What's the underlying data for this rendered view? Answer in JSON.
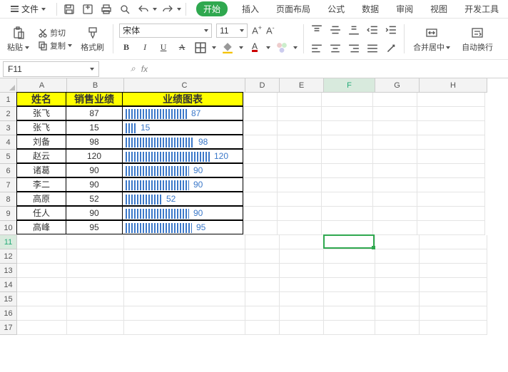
{
  "menu": {
    "file": "文件"
  },
  "tabs": [
    "开始",
    "插入",
    "页面布局",
    "公式",
    "数据",
    "审阅",
    "视图",
    "开发工具"
  ],
  "clipboard": {
    "paste": "粘贴",
    "cut": "剪切",
    "copy": "复制",
    "format_painter": "格式刷"
  },
  "font": {
    "name": "宋体",
    "size": "11",
    "b": "B",
    "i": "I",
    "u": "U",
    "a": "A"
  },
  "align": {
    "merge_center": "合并居中",
    "wrap": "自动换行"
  },
  "namebox": "F11",
  "fx": "fx",
  "columns": [
    "A",
    "B",
    "C",
    "D",
    "E",
    "F",
    "G",
    "H"
  ],
  "row_count": 17,
  "active_col_index": 5,
  "active_row": 11,
  "headers": {
    "name": "姓名",
    "score": "销售业绩",
    "chart": "业绩图表"
  },
  "rows": [
    {
      "name": "张飞",
      "score": 87
    },
    {
      "name": "张飞",
      "score": 15
    },
    {
      "name": "刘备",
      "score": 98
    },
    {
      "name": "赵云",
      "score": 120
    },
    {
      "name": "诸葛",
      "score": 90
    },
    {
      "name": "李二",
      "score": 90
    },
    {
      "name": "高原",
      "score": 52
    },
    {
      "name": "任人",
      "score": 90
    },
    {
      "name": "高峰",
      "score": 95
    }
  ],
  "chart_data": {
    "type": "bar",
    "title": "业绩图表",
    "xlabel": "姓名",
    "ylabel": "销售业绩",
    "categories": [
      "张飞",
      "张飞",
      "刘备",
      "赵云",
      "诸葛",
      "李二",
      "高原",
      "任人",
      "高峰"
    ],
    "values": [
      87,
      15,
      98,
      120,
      90,
      90,
      52,
      90,
      95
    ],
    "ylim": [
      0,
      120
    ]
  },
  "col_widths": {
    "A": 70,
    "B": 80,
    "C": 170,
    "D": 48,
    "E": 62,
    "F": 72,
    "G": 62,
    "H": 95
  },
  "selected_cell": "F11"
}
